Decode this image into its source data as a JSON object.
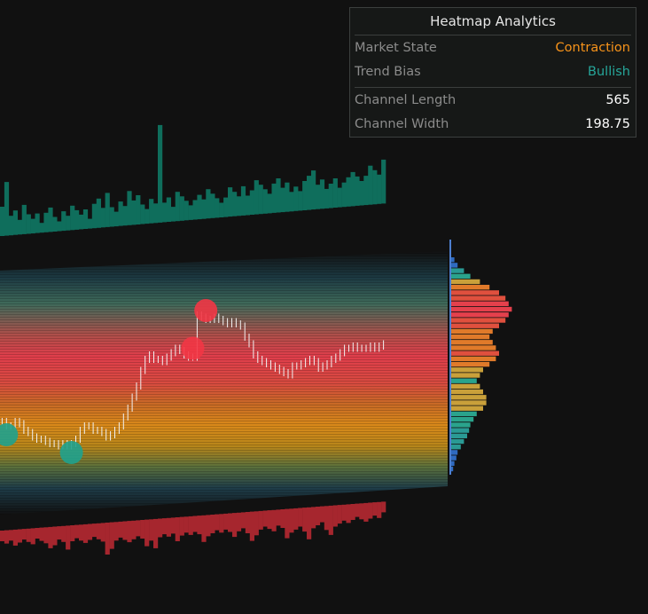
{
  "panel": {
    "title": "Heatmap Analytics",
    "market_state_label": "Market State",
    "market_state_value": "Contraction",
    "trend_bias_label": "Trend Bias",
    "trend_bias_value": "Bullish",
    "channel_length_label": "Channel Length",
    "channel_length_value": "565",
    "channel_width_label": "Channel Width",
    "channel_width_value": "198.75"
  },
  "colors": {
    "background": "#111111",
    "contraction": "#f7931a",
    "bullish": "#26a69a",
    "bull_volume": "#0f6e5c",
    "bear_volume": "#a6262e",
    "marker_bear": "#f23645",
    "marker_bull": "#1fa28e",
    "profile_axis": "#4d7fd0"
  },
  "chart_data": {
    "type": "heatmap",
    "description_free": true,
    "price_series_close": [
      0.22,
      0.2,
      0.2,
      0.22,
      0.21,
      0.18,
      0.17,
      0.15,
      0.14,
      0.14,
      0.13,
      0.12,
      0.12,
      0.11,
      0.12,
      0.11,
      0.12,
      0.14,
      0.18,
      0.2,
      0.2,
      0.18,
      0.18,
      0.17,
      0.15,
      0.16,
      0.18,
      0.2,
      0.24,
      0.28,
      0.33,
      0.38,
      0.45,
      0.5,
      0.52,
      0.5,
      0.5,
      0.49,
      0.51,
      0.53,
      0.55,
      0.54,
      0.52,
      0.51,
      0.51,
      0.7,
      0.69,
      0.68,
      0.68,
      0.69,
      0.68,
      0.67,
      0.66,
      0.67,
      0.66,
      0.65,
      0.6,
      0.57,
      0.52,
      0.5,
      0.49,
      0.48,
      0.47,
      0.46,
      0.45,
      0.44,
      0.43,
      0.47,
      0.47,
      0.48,
      0.49,
      0.5,
      0.49,
      0.46,
      0.47,
      0.48,
      0.5,
      0.51,
      0.53,
      0.55,
      0.55,
      0.56,
      0.55,
      0.55,
      0.55,
      0.56,
      0.55,
      0.56,
      0.57
    ],
    "bull_volume": [
      0.3,
      0.55,
      0.2,
      0.25,
      0.15,
      0.3,
      0.2,
      0.15,
      0.2,
      0.1,
      0.2,
      0.25,
      0.15,
      0.1,
      0.2,
      0.15,
      0.25,
      0.2,
      0.15,
      0.2,
      0.1,
      0.25,
      0.3,
      0.2,
      0.35,
      0.2,
      0.15,
      0.25,
      0.2,
      0.35,
      0.25,
      0.3,
      0.2,
      0.15,
      0.25,
      0.2,
      1.0,
      0.2,
      0.25,
      0.15,
      0.3,
      0.25,
      0.2,
      0.15,
      0.2,
      0.25,
      0.2,
      0.3,
      0.25,
      0.2,
      0.15,
      0.2,
      0.3,
      0.25,
      0.2,
      0.3,
      0.2,
      0.25,
      0.35,
      0.3,
      0.25,
      0.2,
      0.3,
      0.35,
      0.25,
      0.3,
      0.2,
      0.25,
      0.2,
      0.3,
      0.35,
      0.4,
      0.25,
      0.3,
      0.2,
      0.25,
      0.3,
      0.2,
      0.25,
      0.3,
      0.35,
      0.3,
      0.25,
      0.3,
      0.4,
      0.35,
      0.3,
      0.45
    ],
    "bear_volume": [
      0.2,
      0.25,
      0.2,
      0.3,
      0.25,
      0.2,
      0.25,
      0.3,
      0.2,
      0.25,
      0.3,
      0.4,
      0.35,
      0.25,
      0.3,
      0.45,
      0.3,
      0.25,
      0.3,
      0.35,
      0.3,
      0.25,
      0.3,
      0.35,
      0.6,
      0.5,
      0.35,
      0.3,
      0.35,
      0.4,
      0.35,
      0.3,
      0.35,
      0.5,
      0.4,
      0.55,
      0.35,
      0.3,
      0.35,
      0.3,
      0.45,
      0.35,
      0.3,
      0.35,
      0.3,
      0.35,
      0.5,
      0.4,
      0.35,
      0.3,
      0.35,
      0.3,
      0.35,
      0.45,
      0.35,
      0.3,
      0.4,
      0.55,
      0.45,
      0.35,
      0.3,
      0.35,
      0.4,
      0.3,
      0.35,
      0.55,
      0.45,
      0.4,
      0.35,
      0.45,
      0.6,
      0.4,
      0.35,
      0.3,
      0.45,
      0.55,
      0.4,
      0.35,
      0.3,
      0.35,
      0.3,
      0.25,
      0.3,
      0.35,
      0.3,
      0.25,
      0.3,
      0.2
    ],
    "profile": [
      0.05,
      0.1,
      0.2,
      0.3,
      0.45,
      0.6,
      0.75,
      0.85,
      0.9,
      0.95,
      0.9,
      0.85,
      0.75,
      0.65,
      0.6,
      0.65,
      0.7,
      0.75,
      0.7,
      0.6,
      0.5,
      0.45,
      0.4,
      0.45,
      0.5,
      0.55,
      0.55,
      0.5,
      0.4,
      0.35,
      0.3,
      0.28,
      0.25,
      0.2,
      0.15,
      0.1,
      0.08,
      0.05,
      0.03
    ],
    "markers": [
      {
        "type": "bear",
        "index": 44
      },
      {
        "type": "bear",
        "index": 47
      },
      {
        "type": "bull",
        "index": 1
      },
      {
        "type": "bull",
        "index": 16
      }
    ]
  }
}
